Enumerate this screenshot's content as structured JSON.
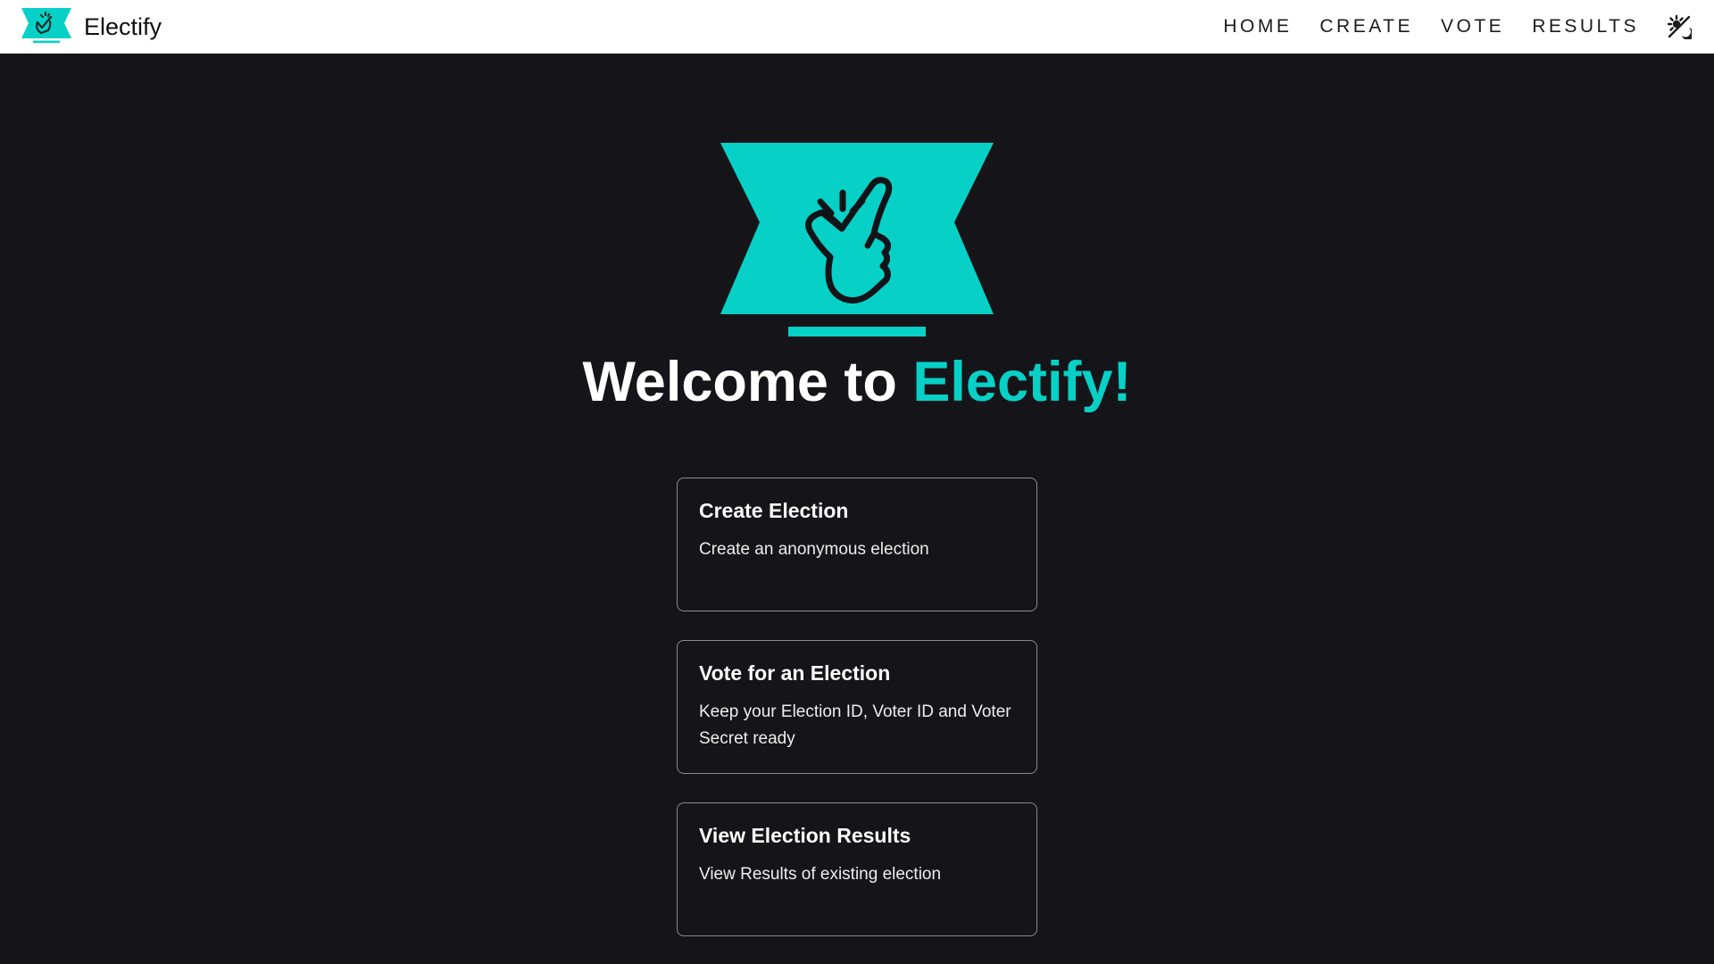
{
  "app": {
    "name": "Electify"
  },
  "nav": {
    "items": [
      {
        "label": "HOME"
      },
      {
        "label": "CREATE"
      },
      {
        "label": "VOTE"
      },
      {
        "label": "RESULTS"
      }
    ],
    "theme_toggle_icon": "theme-toggle-icon"
  },
  "hero": {
    "welcome_prefix": "Welcome to ",
    "welcome_highlight": "Electify!",
    "logo_icon": "snap-finger-icon"
  },
  "cards": [
    {
      "title": "Create Election",
      "description": "Create an anonymous election"
    },
    {
      "title": "Vote for an Election",
      "description": "Keep your Election ID, Voter ID and Voter Secret ready"
    },
    {
      "title": "View Election Results",
      "description": "View Results of existing election"
    }
  ],
  "colors": {
    "accent": "#07d1c6",
    "background": "#151519",
    "topbar": "#ffffff",
    "card_border": "#8a8a90"
  }
}
